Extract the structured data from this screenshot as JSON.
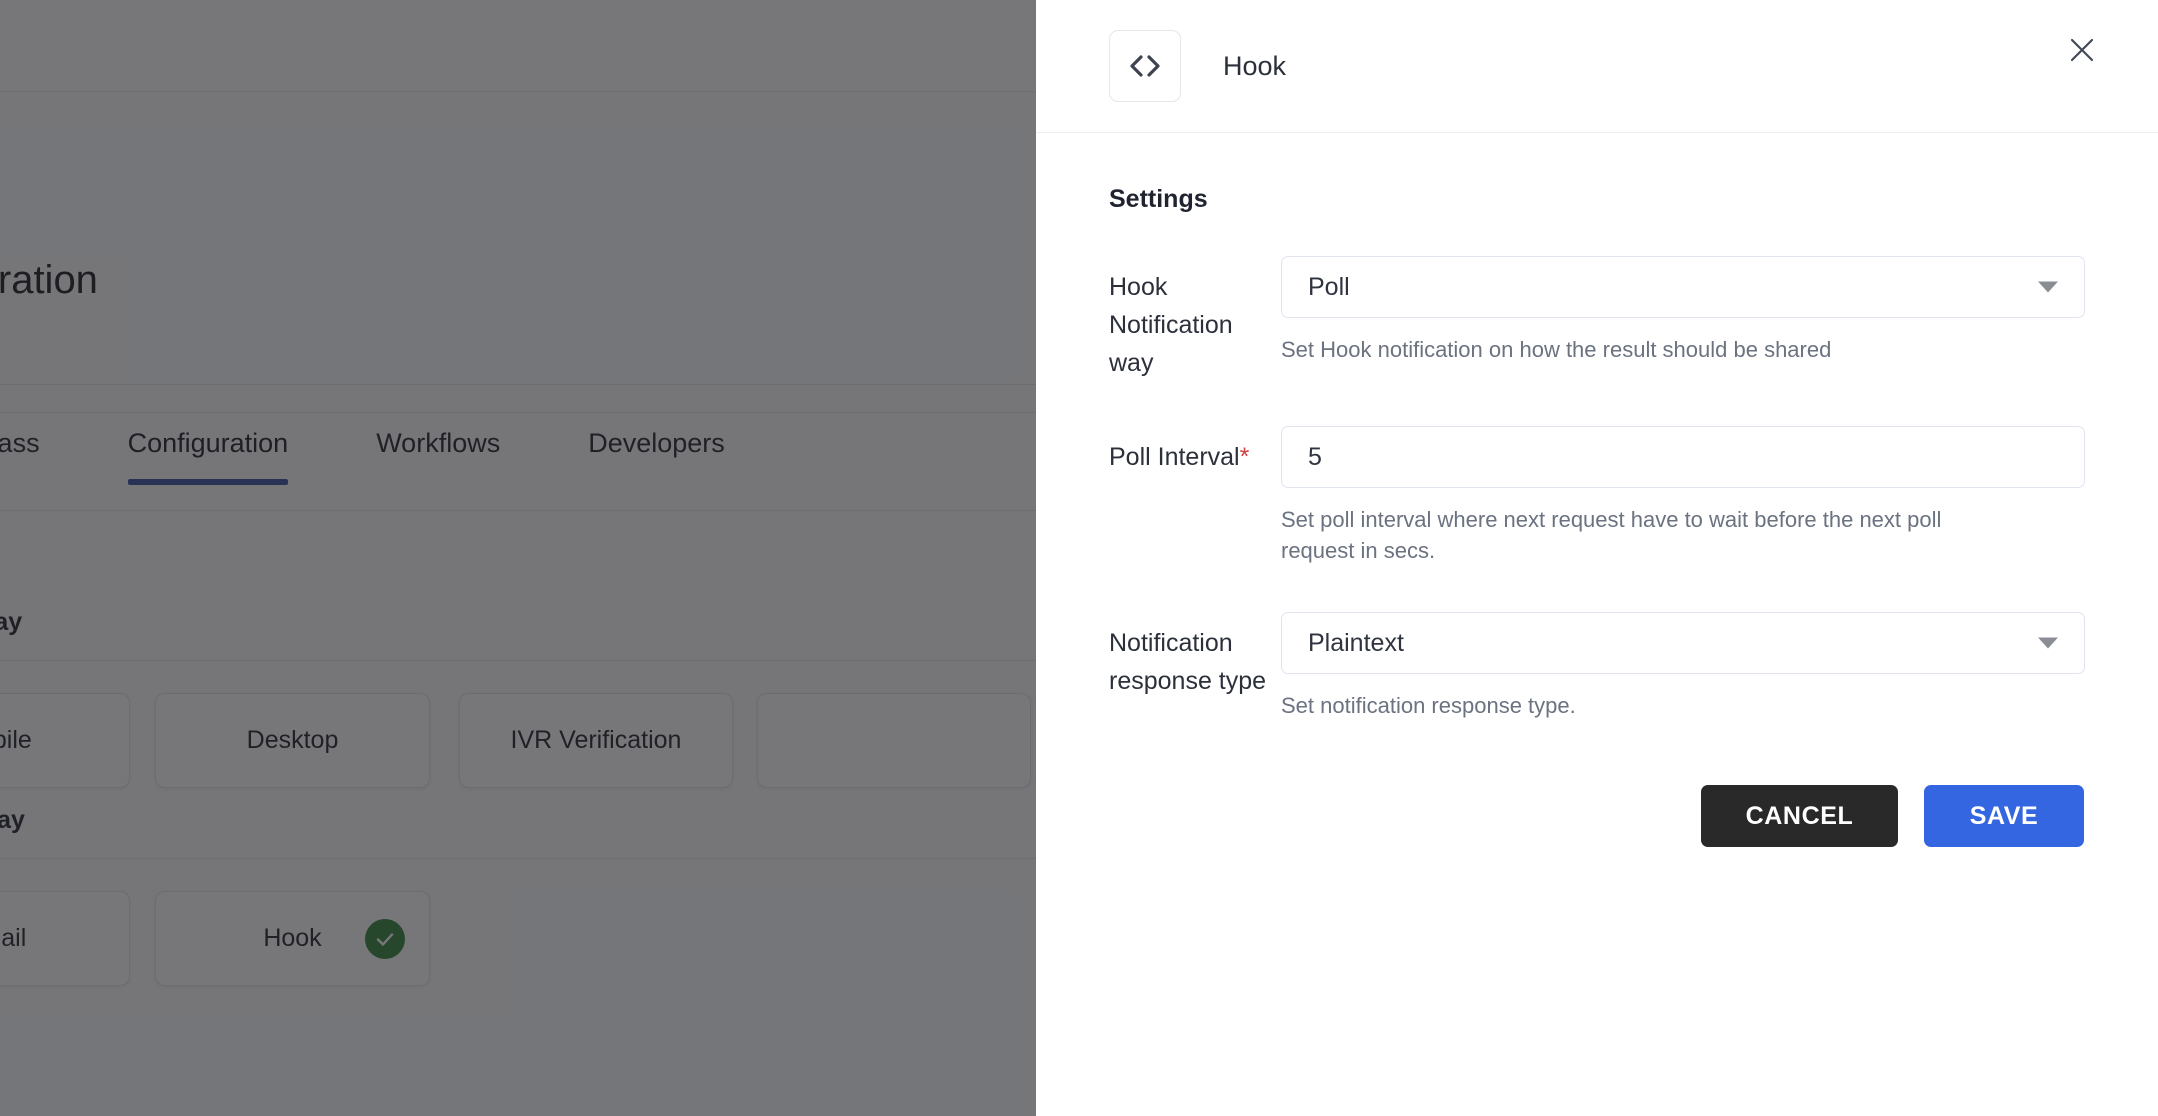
{
  "background": {
    "page_title": "Configuration",
    "tabs": [
      {
        "label": "Gatepass",
        "active": false
      },
      {
        "label": "Configuration",
        "active": true
      },
      {
        "label": "Workflows",
        "active": false
      },
      {
        "label": "Developers",
        "active": false
      }
    ],
    "sections": [
      {
        "title": "Verification Way"
      },
      {
        "title": "Notification Way"
      }
    ],
    "cards_row1": [
      {
        "label": "Mobile",
        "selected": false
      },
      {
        "label": "Desktop",
        "selected": false
      },
      {
        "label": "IVR Verification",
        "selected": false
      }
    ],
    "cards_row2": [
      {
        "label": "Email",
        "selected": false
      },
      {
        "label": "Hook",
        "selected": true
      }
    ]
  },
  "drawer": {
    "icon": "code-icon",
    "title": "Hook",
    "close_icon": "close-icon",
    "settings_heading": "Settings",
    "fields": [
      {
        "label": "Hook Notification way",
        "required": false,
        "type": "select",
        "value": "Poll",
        "helper": "Set Hook notification on how the result should be shared"
      },
      {
        "label": "Poll Interval",
        "required": true,
        "type": "text",
        "value": "5",
        "helper": "Set poll interval where next request have to wait before the next poll request in secs."
      },
      {
        "label": "Notification response type",
        "required": false,
        "type": "select",
        "value": "Plaintext",
        "helper": "Set notification response type."
      }
    ],
    "cancel_label": "CANCEL",
    "save_label": "SAVE"
  },
  "colors": {
    "accent_blue": "#3366e0",
    "tab_underline": "#2e4a9e",
    "cancel_dark": "#292929",
    "required_red": "#cf4040",
    "success_green": "#2f8132",
    "scrim": "rgba(35,36,40,0.62)"
  }
}
